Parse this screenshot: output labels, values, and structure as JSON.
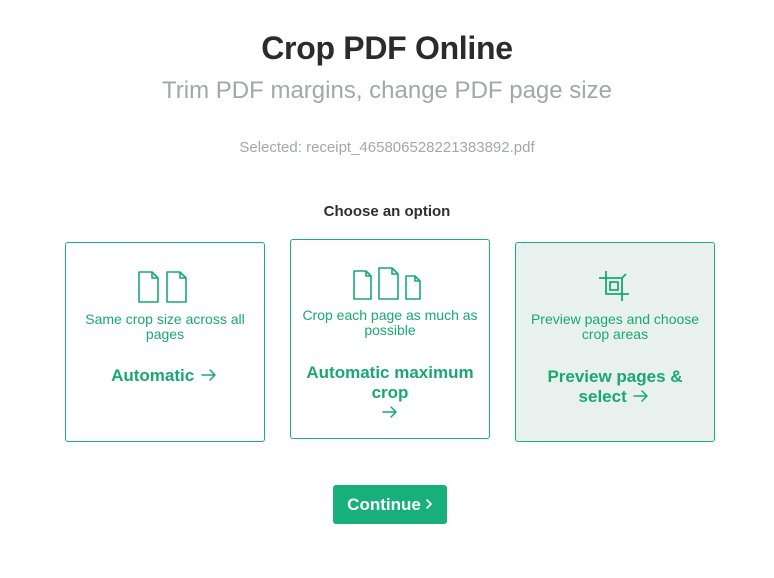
{
  "header": {
    "title": "Crop PDF Online",
    "subtitle": "Trim PDF margins, change PDF page size",
    "selected_file": "Selected: receipt_46580652822138389​2.pdf"
  },
  "options": {
    "heading": "Choose an option",
    "items": [
      {
        "description": "Same crop size across all pages",
        "action": "Automatic",
        "icon": "two-pages-icon",
        "selected": false
      },
      {
        "description": "Crop each page as much as possible",
        "action": "Automatic maximum crop",
        "icon": "three-pages-icon",
        "selected": false
      },
      {
        "description": "Preview pages and choose crop areas",
        "action": "Preview pages & select",
        "icon": "crop-icon",
        "selected": true
      }
    ]
  },
  "footer": {
    "continue_label": "Continue"
  },
  "colors": {
    "accent": "#18b07a",
    "selected_bg": "#e8f1ee",
    "title": "#2b2b2b",
    "muted": "#a3a7ab"
  }
}
